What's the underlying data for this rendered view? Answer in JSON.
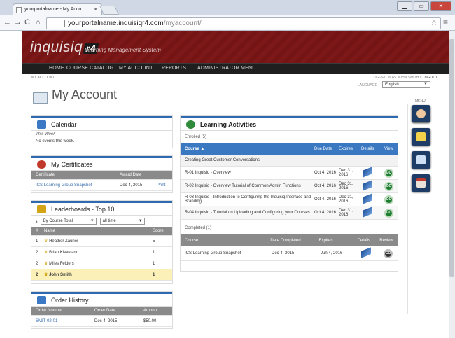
{
  "browser": {
    "tab_title": "yourportalname - My Acco",
    "url_host": "yourportalname.inquisiqr4.com",
    "url_path": "/myaccount/"
  },
  "site": {
    "logo_text": "inquisiq",
    "logo_badge": "r4",
    "tagline": "Learning Management System",
    "menu": [
      "HOME",
      "COURSE CATALOG",
      "MY ACCOUNT",
      "REPORTS",
      "ADMINISTRATOR MENU"
    ]
  },
  "header": {
    "breadcrumb": "MY ACCOUNT",
    "logged_in": "LOGGED IN AS JOHN SMITH //",
    "logout": "LOGOUT",
    "language_label": "LANGUAGE",
    "language_value": "English",
    "page_title": "My Account",
    "menu_label": "MENU"
  },
  "calendar": {
    "title": "Calendar",
    "period": "This Week",
    "empty": "No events this week."
  },
  "certificates": {
    "title": "My Certificates",
    "headers": [
      "Certificate",
      "Award Date"
    ],
    "rows": [
      {
        "name": "ICS Learning Group Snapshot",
        "date": "Dec 4, 2015",
        "action": "Print"
      }
    ]
  },
  "leaderboards": {
    "title": "Leaderboards - Top 10",
    "filter1": "By Course Total",
    "filter2": "all time",
    "headers": [
      "#",
      "Name",
      "Score"
    ],
    "rows": [
      {
        "rank": "1",
        "name": "Heather Zauner",
        "score": "5"
      },
      {
        "rank": "2",
        "name": "Brian Kleveland",
        "score": "1"
      },
      {
        "rank": "2",
        "name": "Miles Felders",
        "score": "1"
      },
      {
        "rank": "2",
        "name": "John Smith",
        "score": "1"
      }
    ]
  },
  "orders": {
    "title": "Order History",
    "headers": [
      "Order Number",
      "Order Date",
      "Amount"
    ],
    "rows": [
      {
        "number": "SMIT-02-01",
        "date": "Dec 4, 2015",
        "amount": "$50.00"
      }
    ]
  },
  "activities": {
    "title": "Learning Activities",
    "enrolled_label": "Enrolled (5)",
    "headers": [
      "Course",
      "Due Date",
      "Expires",
      "Details",
      "View"
    ],
    "rows": [
      {
        "course": "Creating Great Customer Conversations",
        "due": "-",
        "expires": "-"
      },
      {
        "course": "R-01 Inquisiq - Overview",
        "due": "Oct 4, 2016",
        "expires": "Dec 31, 2016"
      },
      {
        "course": "R-02 Inquisiq - Overview Tutorial of Common Admin Functions",
        "due": "Oct 4, 2016",
        "expires": "Dec 31, 2016"
      },
      {
        "course": "R-03 Inquisiq - Introduction to Configuring the Inquisiq Interface and Branding",
        "due": "Oct 4, 2016",
        "expires": "Dec 31, 2016"
      },
      {
        "course": "R-04 Inquisiq - Tutorial on Uploading and Configuring your Courses",
        "due": "Oct 4, 2016",
        "expires": "Dec 31, 2016"
      }
    ],
    "completed_label": "Completed (1)",
    "completed_headers": [
      "Course",
      "Date Completed",
      "Expires",
      "Details",
      "Review"
    ],
    "completed_rows": [
      {
        "course": "ICS Learning Group Snapshot",
        "completed": "Dec 4, 2015",
        "expires": "Jun 4, 2016"
      }
    ],
    "go_label": "GO"
  },
  "colors": {
    "brand_red": "#7c1818",
    "accent_blue": "#2e6ab0",
    "nav_dark": "#1f1f1f",
    "sidebar_navy": "#1d3c66"
  }
}
